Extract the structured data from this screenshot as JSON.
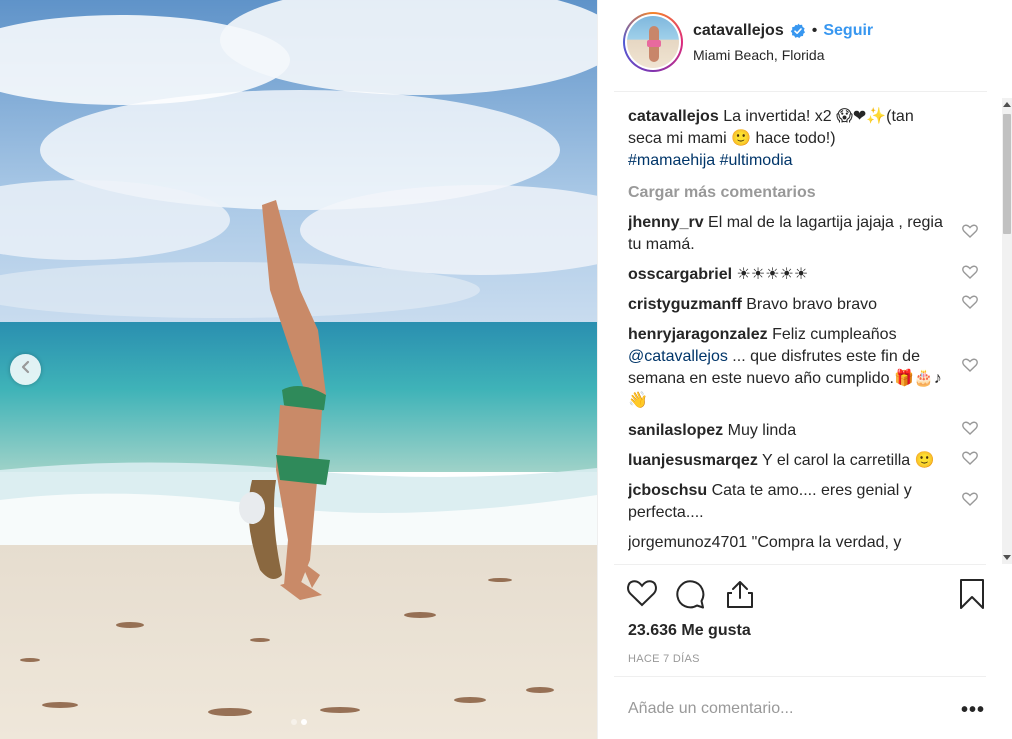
{
  "post": {
    "username": "catavallejos",
    "verified": true,
    "separator": "•",
    "follow_label": "Seguir",
    "location": "Miami Beach, Florida",
    "caption": {
      "username": "catavallejos",
      "text": "La invertida! x2 😱❤✨(tan seca mi mami 🙂 hace todo!)",
      "hashtags": [
        "#mamaehija",
        "#ultimodia"
      ]
    },
    "load_more_label": "Cargar más comentarios",
    "comments": [
      {
        "username": "jhenny_rv",
        "text": "El mal de la lagartija jajaja , regia tu mamá."
      },
      {
        "username": "osscargabriel",
        "text": "☀☀☀☀☀"
      },
      {
        "username": "cristyguzmanff",
        "text": "Bravo bravo bravo"
      },
      {
        "username": "henryjaragonzalez",
        "text_pre": "Feliz cumpleaños",
        "mention": "@catavallejos",
        "text_post": "... que disfrutes este fin de semana en este nuevo año cumplido.🎁🎂♪👋"
      },
      {
        "username": "sanilaslopez",
        "text": "Muy linda"
      },
      {
        "username": "luanjesusmarqez",
        "text": "Y el carol la carretilla 🙂"
      },
      {
        "username": "jcboschsu",
        "text": "Cata te amo.... eres genial y perfecta...."
      }
    ],
    "cut_comment": "jorgemunoz4701 \"Compra la verdad, y",
    "likes_label": "23.636 Me gusta",
    "time_label": "HACE 7 DÍAS",
    "add_comment_placeholder": "Añade un comentario...",
    "more_options_label": "•••",
    "carousel": {
      "slides": 2,
      "active": 1
    }
  },
  "colors": {
    "link": "#3897f0",
    "hashtag": "#003569",
    "muted": "#999999",
    "text": "#262626",
    "verified": "#3897f0"
  },
  "icons": {
    "heart": "heart-icon",
    "comment": "comment-icon",
    "share": "share-icon",
    "save": "bookmark-icon",
    "prev": "chevron-left-icon"
  }
}
